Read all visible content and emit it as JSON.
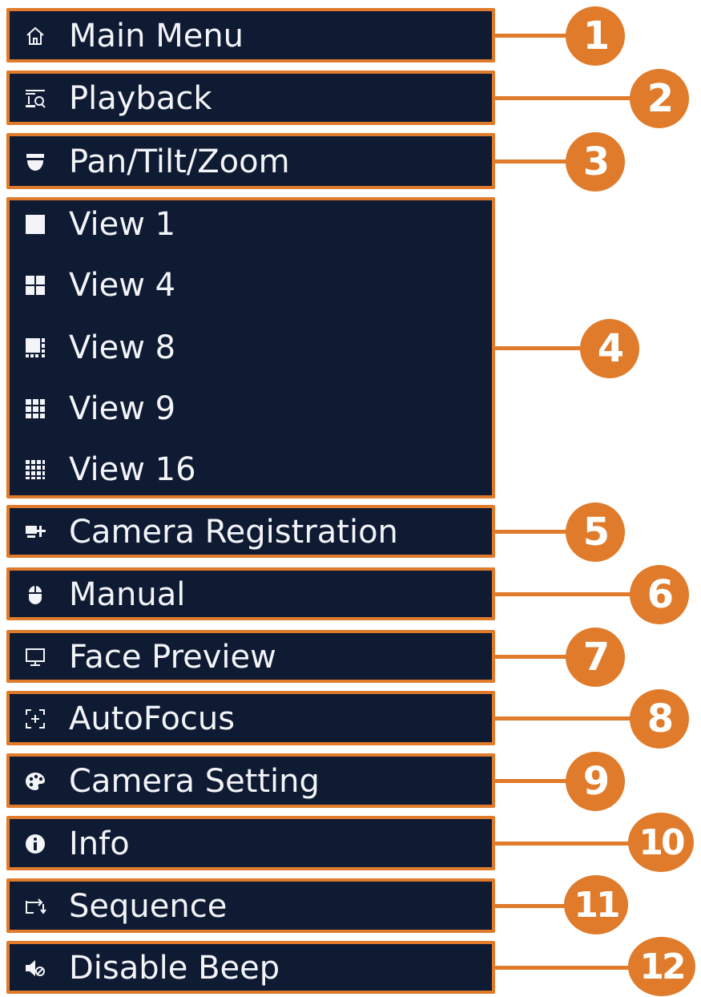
{
  "colors": {
    "panel_bg": "#0f1a33",
    "border": "#e07b2b",
    "text": "#f2f4f8",
    "badge": "#e07b2b"
  },
  "items": [
    {
      "label": "Main Menu",
      "icon": "home-icon"
    },
    {
      "label": "Playback",
      "icon": "playback-icon"
    },
    {
      "label": "Pan/Tilt/Zoom",
      "icon": "ptz-camera-icon"
    },
    {
      "label": "View 1",
      "icon": "view-1-icon"
    },
    {
      "label": "View 4",
      "icon": "view-4-icon"
    },
    {
      "label": "View 8",
      "icon": "view-8-icon"
    },
    {
      "label": "View 9",
      "icon": "view-9-icon"
    },
    {
      "label": "View 16",
      "icon": "view-16-icon"
    },
    {
      "label": "Camera Registration",
      "icon": "camera-registration-icon"
    },
    {
      "label": "Manual",
      "icon": "mouse-icon"
    },
    {
      "label": "Face Preview",
      "icon": "monitor-icon"
    },
    {
      "label": "AutoFocus",
      "icon": "autofocus-icon"
    },
    {
      "label": "Camera Setting",
      "icon": "palette-icon"
    },
    {
      "label": "Info",
      "icon": "info-icon"
    },
    {
      "label": "Sequence",
      "icon": "sequence-icon"
    },
    {
      "label": "Disable Beep",
      "icon": "mute-icon"
    }
  ],
  "callouts": [
    "1",
    "2",
    "3",
    "4",
    "5",
    "6",
    "7",
    "8",
    "9",
    "10",
    "11",
    "12"
  ]
}
